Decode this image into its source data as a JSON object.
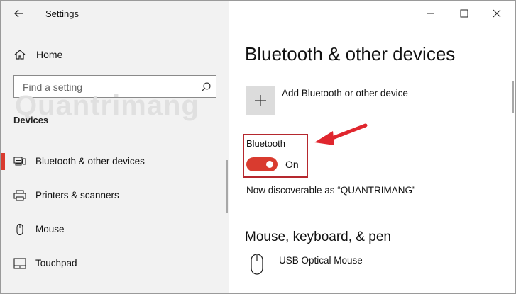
{
  "window": {
    "title": "Settings"
  },
  "sidebar": {
    "home_label": "Home",
    "search_placeholder": "Find a setting",
    "section_label": "Devices",
    "items": [
      {
        "label": "Bluetooth & other devices",
        "icon": "bluetooth-devices-icon",
        "selected": true
      },
      {
        "label": "Printers & scanners",
        "icon": "printer-icon",
        "selected": false
      },
      {
        "label": "Mouse",
        "icon": "mouse-icon",
        "selected": false
      },
      {
        "label": "Touchpad",
        "icon": "touchpad-icon",
        "selected": false
      }
    ]
  },
  "watermark": "Quantrimang",
  "main": {
    "title": "Bluetooth & other devices",
    "add_device_label": "Add Bluetooth or other device",
    "bluetooth": {
      "label": "Bluetooth",
      "state": "On",
      "enabled": true
    },
    "discoverable_text": "Now discoverable as “QUANTRIMANG”",
    "section_mouse": "Mouse, keyboard, & pen",
    "devices": [
      {
        "name": "USB Optical Mouse",
        "icon": "mouse-icon"
      }
    ]
  },
  "colors": {
    "accent": "#d93b2f",
    "highlight_box": "#b5282e",
    "sidebar_bg": "#f2f2f2"
  }
}
